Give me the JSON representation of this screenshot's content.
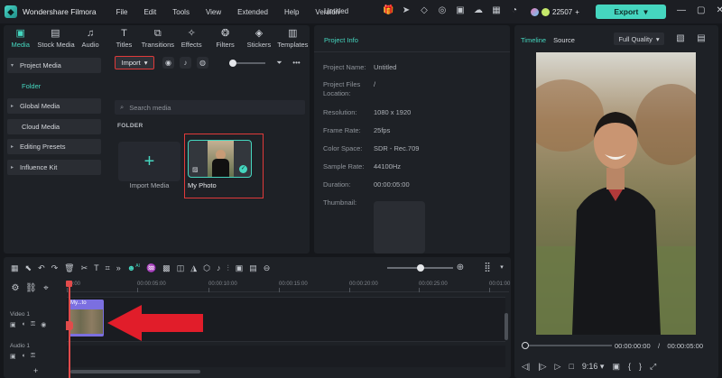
{
  "titlebar": {
    "app_name": "Wondershare Filmora",
    "menu": [
      "File",
      "Edit",
      "Tools",
      "View",
      "Extended",
      "Help",
      "Version"
    ],
    "project_title": "Untitled",
    "credits": "22507",
    "export_label": "Export"
  },
  "toolbar": [
    {
      "label": "Media",
      "icon": "media-icon"
    },
    {
      "label": "Stock Media",
      "icon": "stock-media-icon"
    },
    {
      "label": "Audio",
      "icon": "audio-icon"
    },
    {
      "label": "Titles",
      "icon": "titles-icon"
    },
    {
      "label": "Transitions",
      "icon": "transitions-icon"
    },
    {
      "label": "Effects",
      "icon": "effects-icon"
    },
    {
      "label": "Filters",
      "icon": "filters-icon"
    },
    {
      "label": "Stickers",
      "icon": "stickers-icon"
    },
    {
      "label": "Templates",
      "icon": "templates-icon"
    }
  ],
  "sidebar": {
    "items": [
      {
        "label": "Project Media",
        "expanded": true
      },
      {
        "label": "Folder"
      },
      {
        "label": "Global Media"
      },
      {
        "label": "Cloud Media"
      },
      {
        "label": "Editing Presets"
      },
      {
        "label": "Influence Kit"
      }
    ]
  },
  "media": {
    "import_label": "Import",
    "search_placeholder": "Search media",
    "folder_label": "FOLDER",
    "import_tile_label": "Import Media",
    "photo_label": "My Photo"
  },
  "project_info": {
    "title": "Project Info",
    "rows": [
      {
        "key": "Project Name:",
        "value": "Untitled"
      },
      {
        "key": "Project Files Location:",
        "value": "/"
      },
      {
        "key": "Resolution:",
        "value": "1080 x 1920"
      },
      {
        "key": "Frame Rate:",
        "value": "25fps"
      },
      {
        "key": "Color Space:",
        "value": "SDR - Rec.709"
      },
      {
        "key": "Sample Rate:",
        "value": "44100Hz"
      },
      {
        "key": "Duration:",
        "value": "00:00:05:00"
      },
      {
        "key": "Thumbnail:",
        "value": ""
      }
    ]
  },
  "preview": {
    "tab_timeline": "Timeline",
    "tab_source": "Source",
    "quality": "Full Quality",
    "current_time": "00:00:00:00",
    "separator": "/",
    "total_time": "00:00:05:00",
    "aspect": "9:16"
  },
  "timeline": {
    "ruler": [
      "00:00",
      "00:00:05:00",
      "00:00:10:00",
      "00:00:15:00",
      "00:00:20:00",
      "00:00:25:00",
      "00:00:30:00",
      "00:01:00"
    ],
    "video_track": "Video 1",
    "audio_track": "Audio 1",
    "clip_label": "My...to",
    "ai_badge": "AI"
  },
  "colors": {
    "accent": "#45d6bf",
    "highlight": "#e03a3a",
    "clip": "#7b6fe0"
  }
}
